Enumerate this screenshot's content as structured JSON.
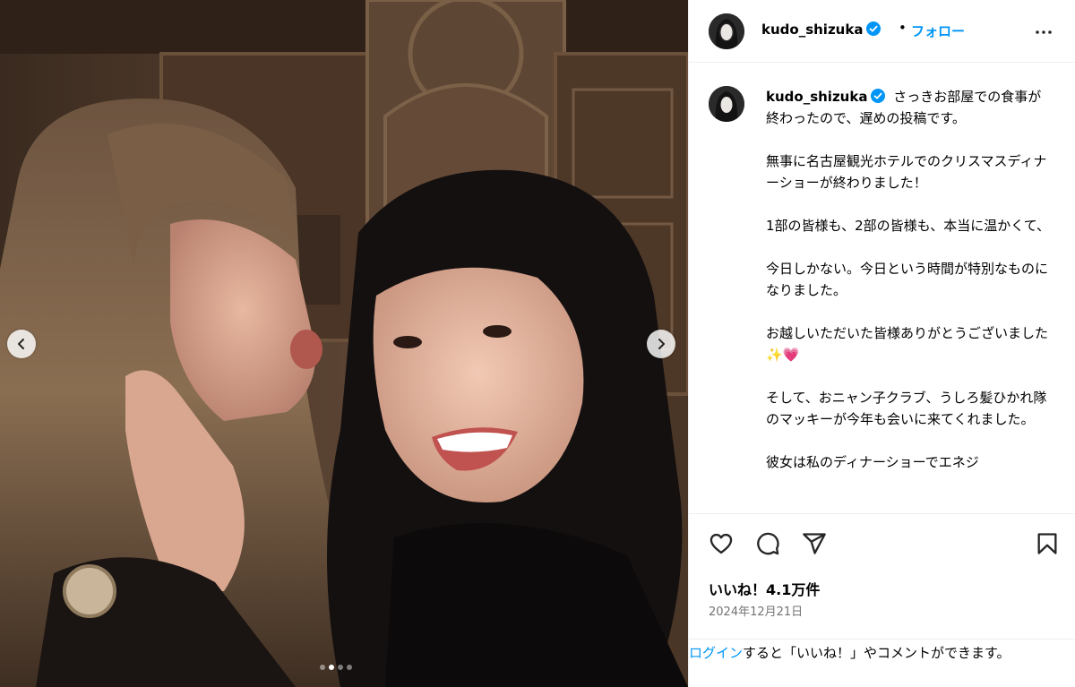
{
  "post": {
    "username": "kudo_shizuka",
    "verified": true,
    "follow_label": "フォロー",
    "header_separator": "•",
    "more_icon": "more-horizontal-icon",
    "caption_text": "さっきお部屋での食事が終わったので、遅めの投稿です。\n\n無事に名古屋観光ホテルでのクリスマスディナーショーが終わりました！\n\n1部の皆様も、2部の皆様も、本当に温かくて、\n\n今日しかない。今日という時間が特別なものになりました。\n\nお越しいただいた皆様ありがとうございました✨💗\n\nそして、おニャン子クラブ、うしろ髪ひかれ隊のマッキーが今年も会いに来てくれました。\n\n彼女は私のディナーショーでエネジ",
    "likes_text": "いいね！4.1万件",
    "date_text": "2024年12月21日",
    "login_link": "ログイン",
    "login_rest": "すると「いいね！」やコメントができます。"
  },
  "carousel": {
    "total": 4,
    "current": 2,
    "prev_icon": "chevron-left-icon",
    "next_icon": "chevron-right-icon"
  },
  "actions": {
    "like_icon": "heart-icon",
    "comment_icon": "comment-icon",
    "share_icon": "send-icon",
    "save_icon": "bookmark-icon"
  },
  "colors": {
    "link_blue": "#0095f6",
    "verified_blue": "#0095f6",
    "muted_gray": "#737373",
    "divider": "#efefef"
  }
}
